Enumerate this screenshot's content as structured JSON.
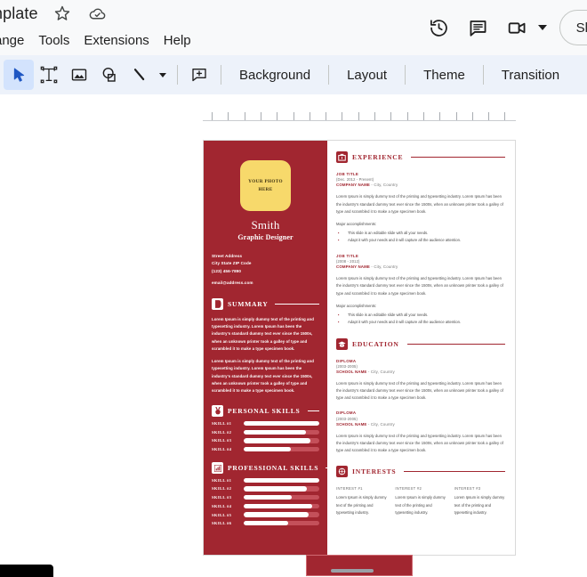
{
  "app": {
    "doc_title": "mplate",
    "star_icon": "star-icon",
    "cloud_icon": "cloud-saved-icon"
  },
  "menubar": {
    "items": [
      {
        "label": "ange",
        "name": "menu-arrange"
      },
      {
        "label": "Tools",
        "name": "menu-tools"
      },
      {
        "label": "Extensions",
        "name": "menu-extensions"
      },
      {
        "label": "Help",
        "name": "menu-help"
      }
    ]
  },
  "topbar_right": {
    "history_icon": "version-history-icon",
    "comment_icon": "comment-icon",
    "camera_icon": "video-camera-icon",
    "camera_caret": "chevron-down-icon",
    "slideshow_label": "Slide"
  },
  "toolbar": {
    "tools": [
      {
        "name": "select-tool",
        "icon": "cursor-arrow-icon",
        "active": true
      },
      {
        "name": "textbox-tool",
        "icon": "text-box-icon",
        "active": false
      },
      {
        "name": "image-tool",
        "icon": "image-icon",
        "active": false
      },
      {
        "name": "shape-tool",
        "icon": "shape-icon",
        "active": false
      },
      {
        "name": "line-tool",
        "icon": "line-icon",
        "active": false
      }
    ],
    "line_caret": "chevron-down-icon",
    "comment_tool_icon": "add-comment-icon",
    "text_buttons": [
      {
        "label": "Background",
        "name": "background-button"
      },
      {
        "label": "Layout",
        "name": "layout-button"
      },
      {
        "label": "Theme",
        "name": "theme-button"
      },
      {
        "label": "Transition",
        "name": "transition-button"
      }
    ]
  },
  "ruler": {
    "tick_count": 19
  },
  "colors": {
    "primary_red": "#A12630",
    "photo_yellow": "#F7D96B",
    "skill_track": "#C4505A",
    "toolbar_bg": "#edf2fa",
    "accent_blue": "#d3e3fd"
  },
  "slide": {
    "left": {
      "photo_line1": "YOUR PHOTO",
      "photo_line2": "HERE",
      "name": "Smith",
      "role": "Graphic Designer",
      "contact": {
        "street": "Street Address",
        "city": "City State ZIP Code",
        "phone": "(123) 456-7890",
        "email": "email@address.com"
      },
      "summary": {
        "icon": "document-icon",
        "title": "SUMMARY",
        "paragraphs": [
          "Lorem Ipsum is simply dummy text of the printing and typesetting industry. Lorem Ipsum has been the industry's standard dummy text ever since the 1500s, when an unknown printer took a galley of type and scrambled it to make a type specimen book.",
          "Lorem Ipsum is simply dummy text of the printing and typesetting industry. Lorem Ipsum has been the industry's standard dummy text ever since the 1500s, when an unknown printer took a galley of type and scrambled it to make a type specimen book."
        ]
      },
      "personal_skills": {
        "icon": "medal-icon",
        "title": "PERSONAL SKILLS",
        "items": [
          {
            "label": "SKILL #1",
            "value": 100
          },
          {
            "label": "SKILL #2",
            "value": 82
          },
          {
            "label": "SKILL #3",
            "value": 88
          },
          {
            "label": "SKILL #4",
            "value": 62
          }
        ]
      },
      "professional_skills": {
        "icon": "bar-chart-icon",
        "title": "PROFESSIONAL SKILLS",
        "items": [
          {
            "label": "SKILL #1",
            "value": 100
          },
          {
            "label": "SKILL #2",
            "value": 84
          },
          {
            "label": "SKILL #3",
            "value": 63
          },
          {
            "label": "SKILL #4",
            "value": 90
          },
          {
            "label": "SKILL #5",
            "value": 86
          },
          {
            "label": "SKILL #6",
            "value": 59
          }
        ]
      }
    },
    "right": {
      "experience": {
        "icon": "briefcase-icon",
        "title": "EXPERIENCE",
        "entries": [
          {
            "job_title": "JOB TITLE",
            "date": "(Dec. 2012 - Present)",
            "company": "COMPANY NAME",
            "location": " - City, Country",
            "description": "Lorem Ipsum is simply dummy text of the printing and typesetting industry. Lorem Ipsum has been the industry's standard dummy text ever since the 1500s, when an unknown printer took a galley of type and scrambled it to make a type specimen book.",
            "accomplishments_label": "Major accomplishments:",
            "bullets": [
              "This slide is an editable slide with all your needs.",
              "Adapt it with your needs and it will capture all the audience attention."
            ]
          },
          {
            "job_title": "JOB TITLE",
            "date": "(2008 - 2012)",
            "company": "COMPANY NAME",
            "location": " - City, Country",
            "description": "Lorem Ipsum is simply dummy text of the printing and typesetting industry. Lorem Ipsum has been the industry's standard dummy text ever since the 1500s, when an unknown printer took a galley of type and scrambled it to make a type specimen book.",
            "accomplishments_label": "Major accomplishments:",
            "bullets": [
              "This slide is an editable slide with all your needs.",
              "Adapt it with your needs and it will capture all the audience attention."
            ]
          }
        ]
      },
      "education": {
        "icon": "graduation-cap-icon",
        "title": "EDUCATION",
        "entries": [
          {
            "degree": "DIPLOMA",
            "date": "(2003-2005)",
            "school": "SCHOOL NAME",
            "location": " - City, Country",
            "description": "Lorem Ipsum is simply dummy text of the printing and typesetting industry. Lorem Ipsum has been the industry's standard dummy text ever since the 1500s, when an unknown printer took a galley of type and scrambled it to make a type specimen book."
          },
          {
            "degree": "DIPLOMA",
            "date": "(2003-2005)",
            "school": "SCHOOL NAME",
            "location": " - City, Country",
            "description": "Lorem Ipsum is simply dummy text of the printing and typesetting industry. Lorem Ipsum has been the industry's standard dummy text ever since the 1500s, when an unknown printer took a galley of type and scrambled it to make a type specimen book."
          }
        ]
      },
      "interests": {
        "icon": "interests-icon",
        "title": "INTERESTS",
        "items": [
          {
            "title": "INTEREST #1",
            "text": "Lorem Ipsum is simply dummy text of the printing and typesetting industry."
          },
          {
            "title": "INTEREST #2",
            "text": "Lorem Ipsum is simply dummy text of the printing and typesetting industry."
          },
          {
            "title": "INTEREST #3",
            "text": "Lorem Ipsum is simply dummy text of the printing and typesetting industry."
          }
        ]
      }
    }
  }
}
